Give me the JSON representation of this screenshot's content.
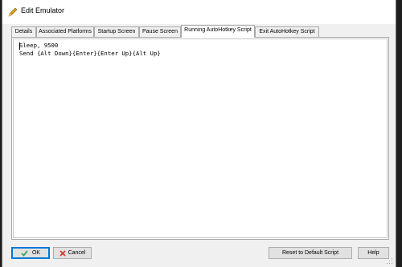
{
  "window": {
    "title": "Edit Emulator"
  },
  "tabs": [
    {
      "label": "Details"
    },
    {
      "label": "Associated Platforms"
    },
    {
      "label": "Startup Screen"
    },
    {
      "label": "Pause Screen"
    },
    {
      "label": "Running AutoHotkey Script",
      "active": true
    },
    {
      "label": "Exit AutoHotkey Script"
    }
  ],
  "editor": {
    "lines": [
      "Sleep, 9500",
      "Send {Alt Down}{Enter}{Enter Up}{Alt Up}"
    ]
  },
  "buttons": {
    "ok": "OK",
    "cancel": "Cancel",
    "reset": "Reset to Default Script",
    "help": "Help"
  },
  "icons": {
    "title": "pencil-icon",
    "ok": "checkmark-icon",
    "cancel": "x-icon"
  },
  "colors": {
    "ok_check": "#3aa655",
    "cancel_x": "#d9302c",
    "focus": "#0078d7"
  }
}
